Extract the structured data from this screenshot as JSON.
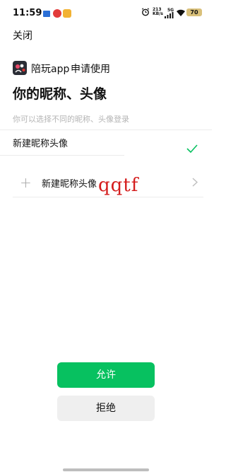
{
  "status_bar": {
    "time": "11:59",
    "net_speed_value": "213",
    "net_speed_unit": "KB/s",
    "network": "5G",
    "battery": "70",
    "notification_icons": [
      "message-icon",
      "notification-badge-icon",
      "app-icon"
    ]
  },
  "header": {
    "close_label": "关闭"
  },
  "app": {
    "name": "陪玩app",
    "request_text": "申请使用"
  },
  "page": {
    "title": "你的昵称、头像",
    "subtitle": "你可以选择不同的昵称、头像登录"
  },
  "options": {
    "selected_label": "新建昵称头像",
    "new_label": "新建昵称头像"
  },
  "annotation": {
    "handwritten_text": "qqtf"
  },
  "actions": {
    "allow_label": "允许",
    "reject_label": "拒绝"
  },
  "colors": {
    "primary": "#07c160",
    "reject_bg": "#efefef",
    "annotation": "#d41d1d"
  }
}
